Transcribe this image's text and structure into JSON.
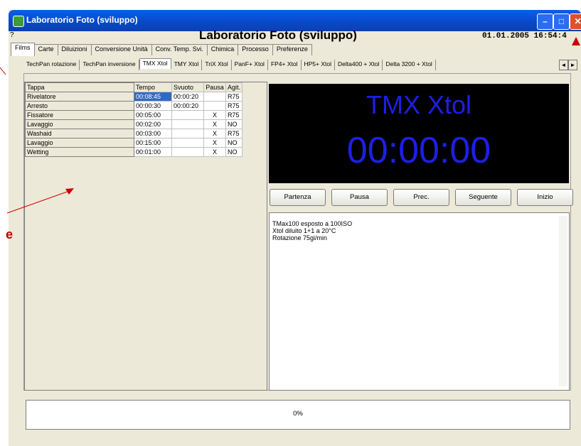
{
  "window": {
    "title": "Laboratorio Foto (sviluppo)"
  },
  "header": {
    "title": "Laboratorio Foto (sviluppo)",
    "help_mark": "?",
    "datetime": "01.01.2005 16:54:4"
  },
  "main_tabs": [
    "Films",
    "Carte",
    "Diluizioni",
    "Conversione Unità",
    "Conv. Temp. Svi.",
    "Chimica",
    "Processo",
    "Preferenze"
  ],
  "sub_tabs": [
    "TechPan rotazione",
    "TechPan inversione",
    "TMX Xtol",
    "TMY Xtol",
    "TriX Xtol",
    "PanF+ Xtol",
    "FP4+ Xtol",
    "HP5+ Xtol",
    "Delta400 + Xtol",
    "Delta 3200 + Xtol"
  ],
  "steps_table": {
    "headers": [
      "Tappa",
      "Tempo",
      "Svuoto",
      "Pausa",
      "Agit."
    ],
    "rows": [
      [
        "Rivelatore",
        "00:08:45",
        "00:00:20",
        "",
        "R75"
      ],
      [
        "Arresto",
        "00:00:30",
        "00:00:20",
        "",
        "R75"
      ],
      [
        "Fissatore",
        "00:05:00",
        "",
        "X",
        "R75"
      ],
      [
        "Lavaggio",
        "00:02:00",
        "",
        "X",
        "NO"
      ],
      [
        "Washaid",
        "00:03:00",
        "",
        "X",
        "R75"
      ],
      [
        "Lavaggio",
        "00:15:00",
        "",
        "X",
        "NO"
      ],
      [
        "Wetting",
        "00:01:00",
        "",
        "X",
        "NO"
      ]
    ]
  },
  "display": {
    "name": "TMX Xtol",
    "timer": "00:00:00"
  },
  "buttons": [
    "Partenza",
    "Pausa",
    "Prec.",
    "Seguente",
    "Inizio"
  ],
  "notes": [
    "TMax100 esposto a 100ISO",
    "Xtol diluito 1+1 a 20°C",
    "Rotazione 75gi/min"
  ],
  "progress": {
    "text": "0%"
  },
  "annotation": {
    "letter": "e"
  },
  "colors": {
    "display_bg": "#000000",
    "display_text": "#1e1ee6",
    "titlebar": "#0a5ee8",
    "annotation": "#cc0000"
  }
}
